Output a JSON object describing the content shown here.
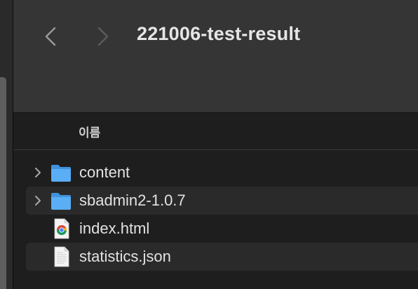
{
  "window": {
    "title": "221006-test-result"
  },
  "toolbar": {
    "back_icon": "chevron-left-icon",
    "forward_icon": "chevron-right-icon"
  },
  "columns": {
    "name": "이름"
  },
  "files": [
    {
      "name": "content",
      "kind": "folder",
      "icon": "folder-icon",
      "expandable": true
    },
    {
      "name": "sbadmin2-1.0.7",
      "kind": "folder",
      "icon": "folder-icon",
      "expandable": true
    },
    {
      "name": "index.html",
      "kind": "html",
      "icon": "chrome-document-icon",
      "expandable": false
    },
    {
      "name": "statistics.json",
      "kind": "json",
      "icon": "document-icon",
      "expandable": false
    }
  ],
  "colors": {
    "folder": "#5aaef5",
    "text": "#e2e2e2",
    "toolbar": "#353535",
    "background": "#1e1e1e"
  }
}
